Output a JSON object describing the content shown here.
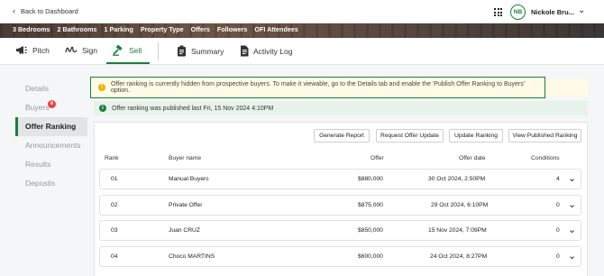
{
  "topbar": {
    "back_label": "Back to Dashboard",
    "user_initials": "NB",
    "user_name": "Nickole Bru..."
  },
  "property_attributes": [
    "3 Bedrooms",
    "2 Bathrooms",
    "1 Parking",
    "Property Type",
    "Offers",
    "Followers",
    "OFI Attendees"
  ],
  "toolbar": {
    "pitch": "Pitch",
    "sign": "Sign",
    "sell": "Sell",
    "summary": "Summary",
    "activity_log": "Activity Log",
    "active": "sell"
  },
  "sidebar": {
    "items": [
      {
        "label": "Details"
      },
      {
        "label": "Buyers",
        "badge": "6"
      },
      {
        "label": "Offer Ranking",
        "active": true
      },
      {
        "label": "Announcements"
      },
      {
        "label": "Results"
      },
      {
        "label": "Deposits"
      }
    ]
  },
  "alerts": {
    "warning": "Offer ranking is currently hidden from prospective buyers. To make it viewable, go to the Details tab and enable the 'Publish Offer Ranking to Buyers' option.",
    "success": "Offer ranking was published last Fri, 15 Nov 2024 4:10PM"
  },
  "actions": {
    "generate_report": "Generate Report",
    "request_offer_update": "Request Offer Update",
    "update_ranking": "Update Ranking",
    "view_published_ranking": "View Published Ranking"
  },
  "table": {
    "headers": {
      "rank": "Rank",
      "buyer_name": "Buyer name",
      "offer": "Offer",
      "offer_date": "Offer date",
      "conditions": "Conditions"
    },
    "rows": [
      {
        "rank": "01",
        "buyer": "Manual Buyers",
        "offer": "$880,000",
        "date": "30 Oct 2024, 2:50PM",
        "conditions": "4"
      },
      {
        "rank": "02",
        "buyer": "Private Offer",
        "offer": "$875,000",
        "date": "29 Oct 2024, 6:10PM",
        "conditions": "0"
      },
      {
        "rank": "03",
        "buyer": "Juan CRUZ",
        "offer": "$850,000",
        "date": "15 Nov 2024, 7:09PM",
        "conditions": "0"
      },
      {
        "rank": "04",
        "buyer": "Choco MARTINS",
        "offer": "$600,000",
        "date": "24 Oct 2024, 8:27PM",
        "conditions": "0"
      }
    ]
  },
  "colors": {
    "accent": "#1a7f3c",
    "badge": "#e04848",
    "warning_icon": "#e8b400",
    "warning_bg": "#fffbe6",
    "success_bg": "#e7f3ea"
  },
  "icons": {
    "back": "chevron-left-icon",
    "apps": "grid-icon",
    "user_menu": "chevron-down-icon",
    "pitch": "megaphone-icon",
    "sign": "signature-icon",
    "sell": "gavel-icon",
    "summary": "clipboard-icon",
    "activity_log": "document-icon",
    "warning": "warning-icon",
    "success": "info-icon",
    "row_expand": "chevron-down-icon"
  }
}
